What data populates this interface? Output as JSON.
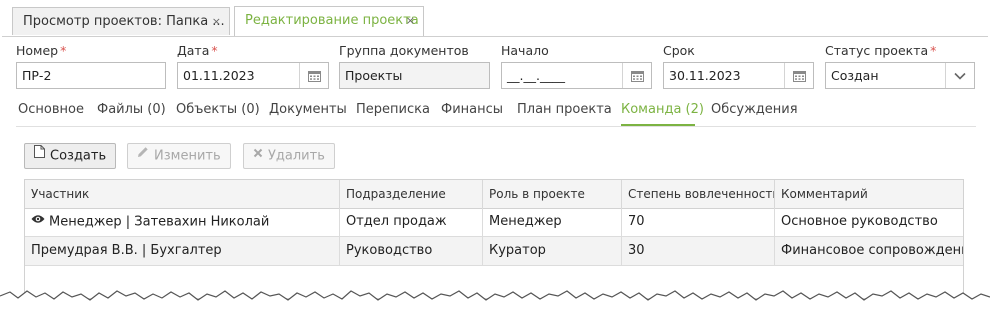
{
  "top_tabs": [
    {
      "label": "Просмотр проектов: Папка ...",
      "close": "×"
    },
    {
      "label": "Редактирование проекта",
      "close": "×"
    }
  ],
  "fields": {
    "number": {
      "label": "Номер",
      "required": "*",
      "value": "ПР-2"
    },
    "date": {
      "label": "Дата",
      "required": "*",
      "value": "01.11.2023"
    },
    "group": {
      "label": "Группа документов",
      "value": "Проекты"
    },
    "start": {
      "label": "Начало",
      "value": "__.__.____"
    },
    "due": {
      "label": "Срок",
      "value": "30.11.2023"
    },
    "status": {
      "label": "Статус проекта",
      "required": "*",
      "value": "Создан"
    }
  },
  "section_tabs": [
    "Основное",
    "Файлы (0)",
    "Объекты (0)",
    "Документы",
    "Переписка",
    "Финансы",
    "План проекта",
    "Команда (2)",
    "Обсуждения"
  ],
  "active_section": "Команда (2)",
  "toolbar": {
    "create": "Создать",
    "edit": "Изменить",
    "delete": "Удалить"
  },
  "table": {
    "columns": [
      "Участник",
      "Подразделение",
      "Роль в проекте",
      "Степень вовлеченности",
      "Комментарий"
    ],
    "rows": [
      {
        "member": "Менеджер | Затевахин Николай",
        "department": "Отдел продаж",
        "role": "Менеджер",
        "involvement": "70",
        "comment": "Основное руководство",
        "icon": "eye-icon"
      },
      {
        "member": "Премудрая В.В. | Бухгалтер",
        "department": "Руководство",
        "role": "Куратор",
        "involvement": "30",
        "comment": "Финансовое сопровождение"
      }
    ]
  },
  "colors": {
    "accent": "#7cb342",
    "required": "#d9534f"
  }
}
